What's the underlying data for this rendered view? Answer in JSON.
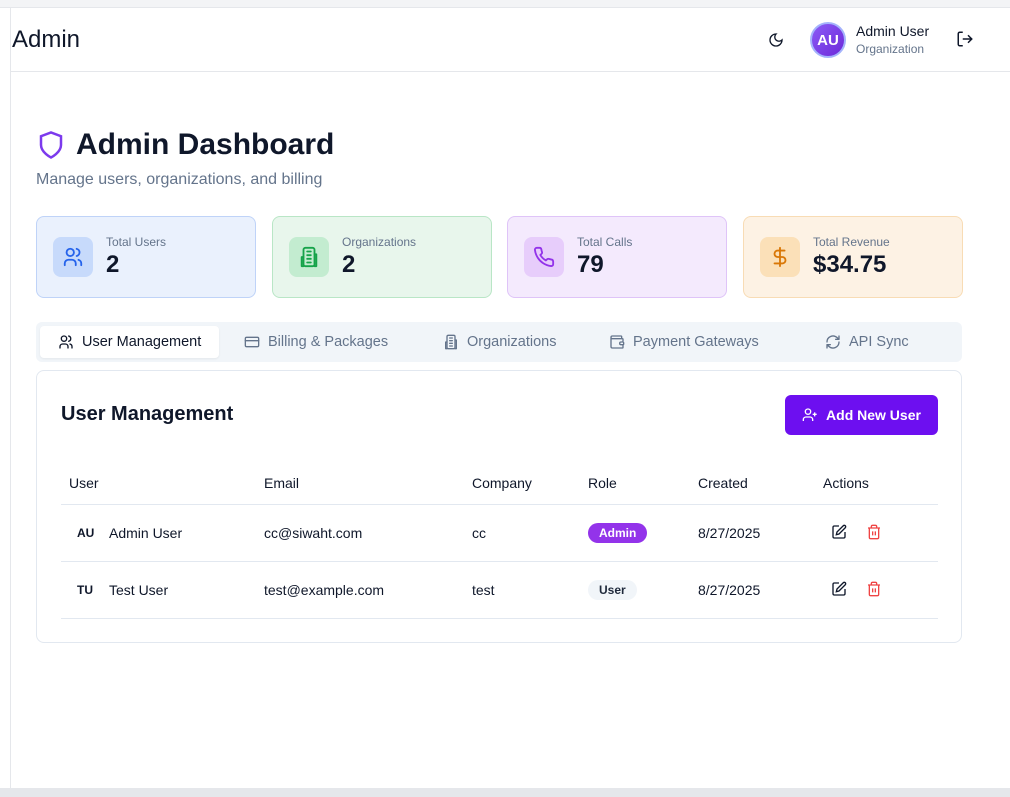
{
  "header": {
    "title": "Admin",
    "user_name": "Admin User",
    "user_org": "Organization",
    "avatar_initials": "AU"
  },
  "page": {
    "title": "Admin Dashboard",
    "subtitle": "Manage users, organizations, and billing"
  },
  "stats": [
    {
      "label": "Total Users",
      "value": "2",
      "icon": "users-icon",
      "bg": "#eaf1fd",
      "border": "#bfd3f8",
      "icon_bg": "#c7dafb",
      "icon_color": "#2563eb"
    },
    {
      "label": "Organizations",
      "value": "2",
      "icon": "building-icon",
      "bg": "#e8f6ec",
      "border": "#b9e6c6",
      "icon_bg": "#c3ecd0",
      "icon_color": "#16a34a"
    },
    {
      "label": "Total Calls",
      "value": "79",
      "icon": "phone-icon",
      "bg": "#f4eafd",
      "border": "#dfc4f8",
      "icon_bg": "#e7cdfb",
      "icon_color": "#9333ea"
    },
    {
      "label": "Total Revenue",
      "value": "$34.75",
      "icon": "dollar-icon",
      "bg": "#fdf2e4",
      "border": "#f8dcb5",
      "icon_bg": "#fbe0b8",
      "icon_color": "#d97706"
    }
  ],
  "tabs": [
    {
      "label": "User Management",
      "icon": "users-icon",
      "active": true
    },
    {
      "label": "Billing & Packages",
      "icon": "credit-card-icon"
    },
    {
      "label": "Organizations",
      "icon": "building-icon"
    },
    {
      "label": "Payment Gateways",
      "icon": "wallet-icon"
    },
    {
      "label": "API Sync",
      "icon": "refresh-icon"
    }
  ],
  "panel": {
    "title": "User Management",
    "add_button": "Add New User",
    "columns": [
      "User",
      "Email",
      "Company",
      "Role",
      "Created",
      "Actions"
    ],
    "rows": [
      {
        "initials": "AU",
        "name": "Admin User",
        "email": "cc@siwaht.com",
        "company": "cc",
        "role": "Admin",
        "created": "8/27/2025"
      },
      {
        "initials": "TU",
        "name": "Test User",
        "email": "test@example.com",
        "company": "test",
        "role": "User",
        "created": "8/27/2025"
      }
    ]
  },
  "colors": {
    "accent": "#6d0ff0",
    "admin_badge": "#9333ea",
    "delete": "#ef4444"
  }
}
